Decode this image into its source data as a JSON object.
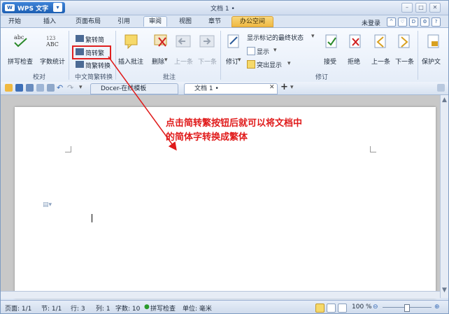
{
  "app": {
    "name": "WPS 文字",
    "doc_title": "文档 1 •"
  },
  "tabs": [
    "开始",
    "插入",
    "页面布局",
    "引用",
    "审阅",
    "视图",
    "章节",
    "办公空间"
  ],
  "active_tab": "审阅",
  "login": "未登录",
  "ribbon": {
    "proofing": {
      "spell_check": "拼写检查",
      "word_count": "字数统计",
      "label": "校对"
    },
    "chinese": {
      "to_traditional": "繁转简",
      "to_simplified": "简转繁",
      "convert": "简繁转换",
      "label": "中文简繁转换"
    },
    "comments": {
      "insert": "插入批注",
      "delete": "删除",
      "prev": "上一条",
      "next": "下一条",
      "label": "批注"
    },
    "tracking": {
      "revise": "修订",
      "display_mode": "显示标记的最终状态",
      "show": "显示",
      "highlight": "突出显示",
      "accept": "接受",
      "reject": "拒绝",
      "prev": "上一条",
      "next": "下一条",
      "label": "修订"
    },
    "protect": "保护文"
  },
  "doc_tabs": {
    "template": "Docer-在线模板",
    "current": "文档 1 •"
  },
  "annotation": {
    "line1": "点击简转繁按钮后就可以将文档中",
    "line2": "的简体字转换成繁体"
  },
  "statusbar": {
    "page": "页面: 1/1",
    "section": "节: 1/1",
    "line": "行: 3",
    "column": "列: 1",
    "words": "字数: 10",
    "spell": "拼写检查",
    "unit": "单位: 毫米",
    "zoom": "100 %"
  },
  "colors": {
    "accent": "#1d5fb3",
    "annotation": "#e01a1a",
    "ribbon": "#e5edf8"
  }
}
